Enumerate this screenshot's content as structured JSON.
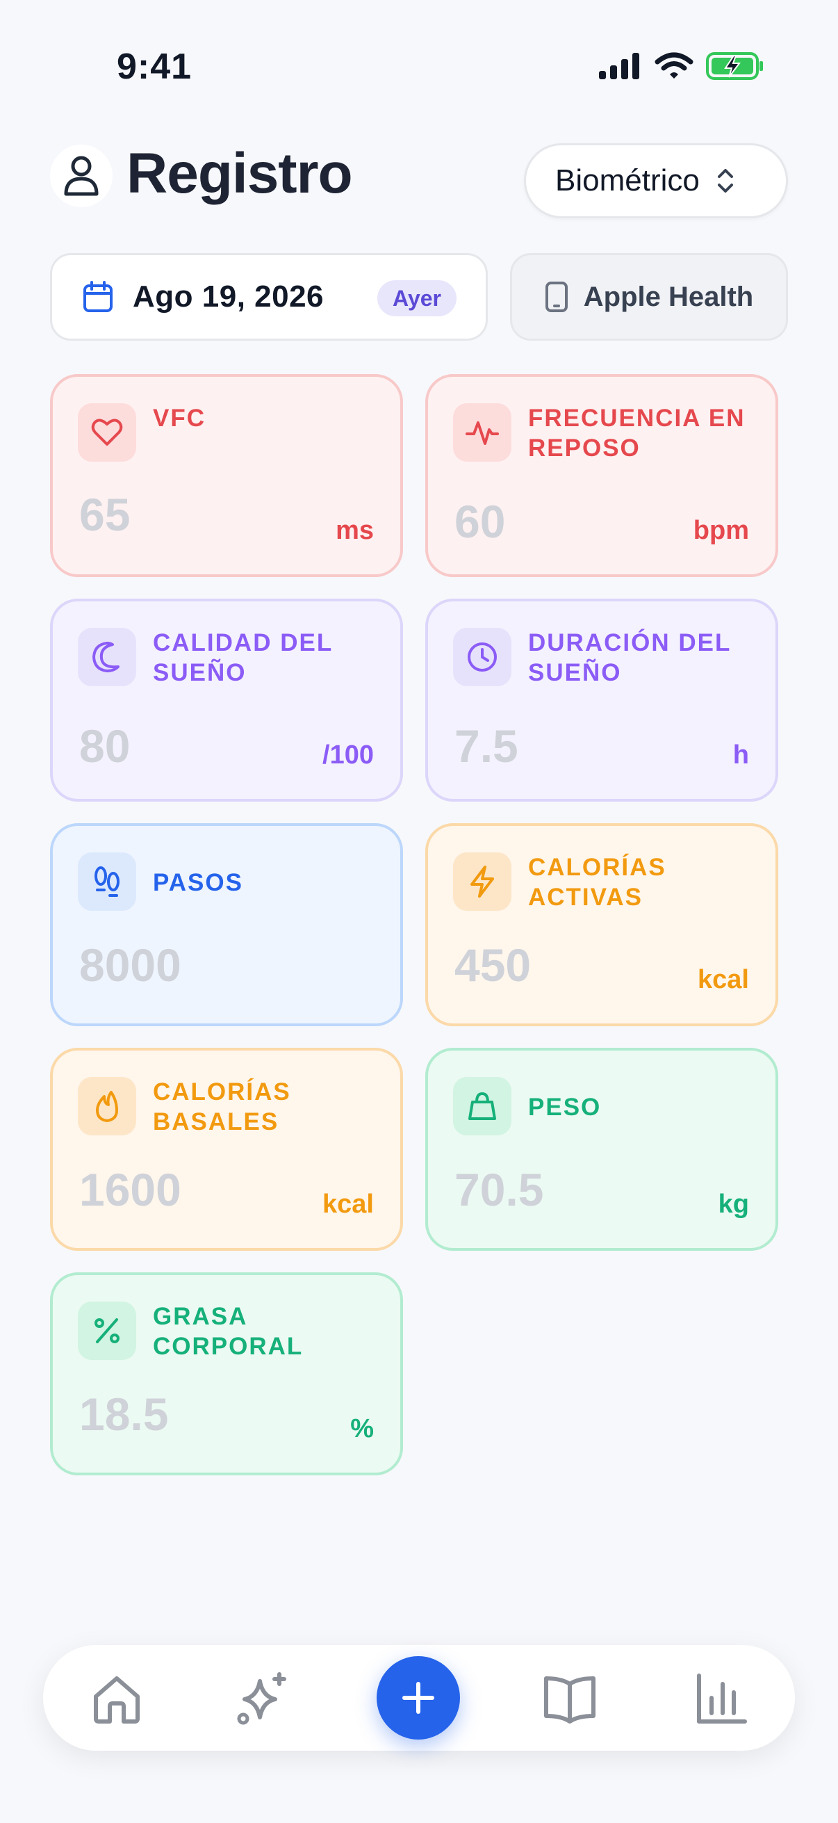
{
  "status_bar": {
    "time": "9:41"
  },
  "header": {
    "title": "Registro",
    "type_selector": "Biométrico"
  },
  "date_row": {
    "date": "Ago 19, 2026",
    "badge": "Ayer",
    "source": "Apple Health"
  },
  "metrics": [
    {
      "title": "VFC",
      "value": "65",
      "unit": "ms",
      "icon": "heart-icon",
      "color": "#e5484d"
    },
    {
      "title": "FRECUENCIA EN REPOSO",
      "value": "60",
      "unit": "bpm",
      "icon": "activity-pulse-icon",
      "color": "#e5484d"
    },
    {
      "title": "CALIDAD DEL SUEÑO",
      "value": "80",
      "unit": "/100",
      "icon": "moon-icon",
      "color": "#8b5cf6"
    },
    {
      "title": "DURACIÓN DEL SUEÑO",
      "value": "7.5",
      "unit": "h",
      "icon": "clock-icon",
      "color": "#8b5cf6"
    },
    {
      "title": "PASOS",
      "value": "8000",
      "unit": "",
      "icon": "footprints-icon",
      "color": "#2563eb"
    },
    {
      "title": "CALORÍAS ACTIVAS",
      "value": "450",
      "unit": "kcal",
      "icon": "lightning-icon",
      "color": "#f29a0f"
    },
    {
      "title": "CALORÍAS BASALES",
      "value": "1600",
      "unit": "kcal",
      "icon": "flame-icon",
      "color": "#f29a0f"
    },
    {
      "title": "PESO",
      "value": "70.5",
      "unit": "kg",
      "icon": "weight-icon",
      "color": "#16b07a"
    },
    {
      "title": "GRASA CORPORAL",
      "value": "18.5",
      "unit": "%",
      "icon": "percent-icon",
      "color": "#16b07a"
    }
  ],
  "nav": {
    "items": [
      {
        "icon": "home-icon"
      },
      {
        "icon": "sparkles-icon"
      },
      {
        "icon": "plus-icon"
      },
      {
        "icon": "book-icon"
      },
      {
        "icon": "bar-chart-icon"
      }
    ],
    "accent": "#2563eb"
  }
}
